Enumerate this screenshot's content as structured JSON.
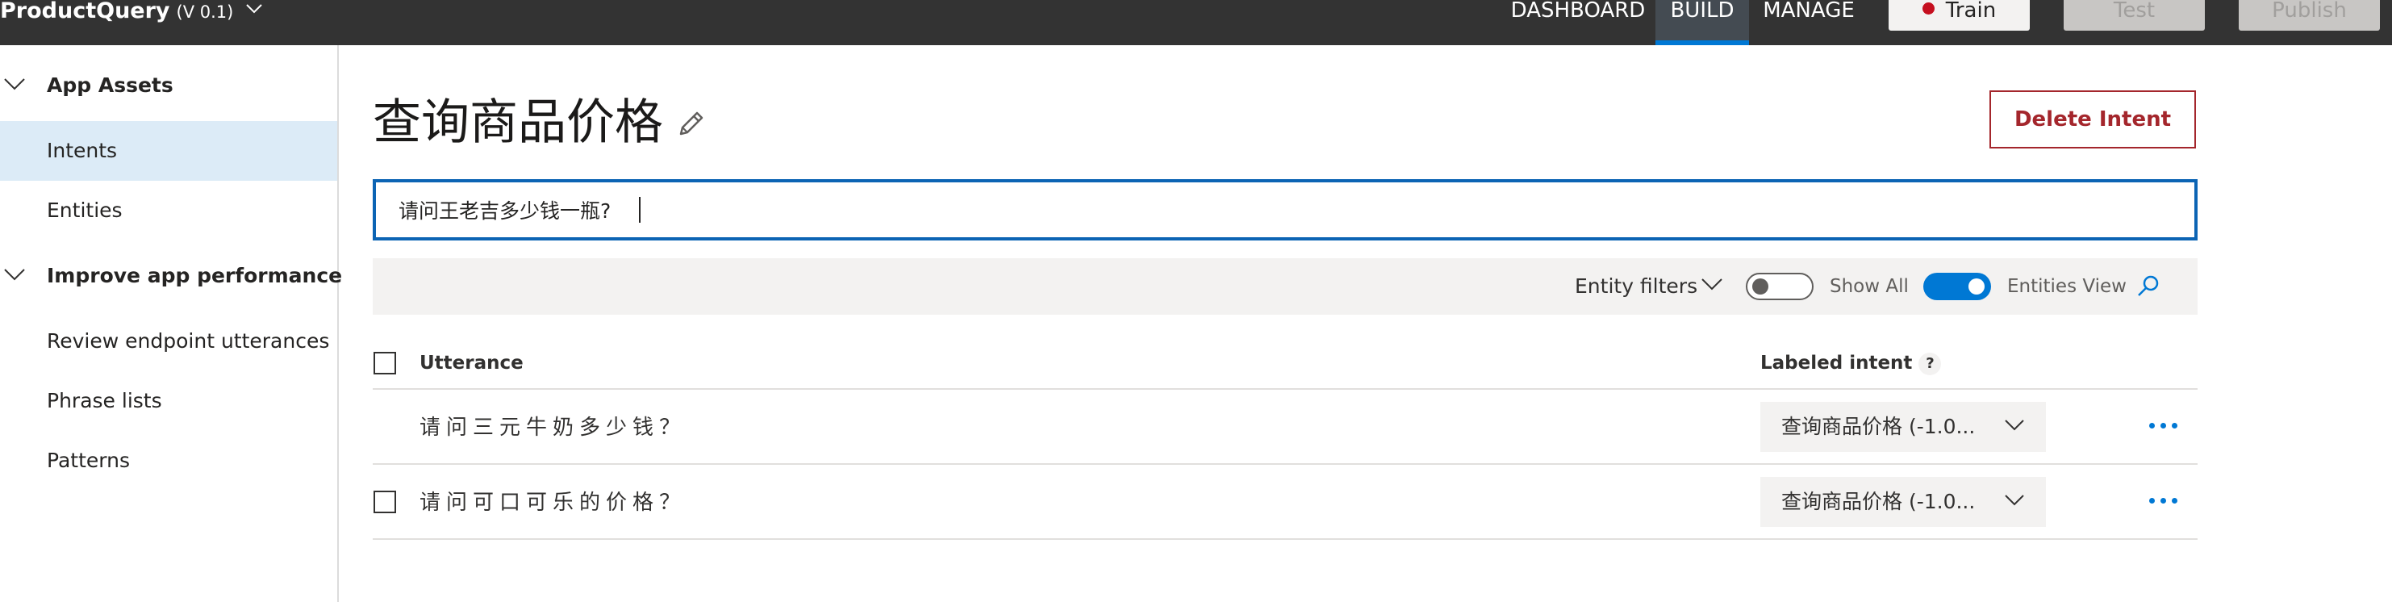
{
  "topbar": {
    "app_name": "ProductQuery",
    "app_version": "(V 0.1)",
    "nav": [
      "DASHBOARD",
      "BUILD",
      "MANAGE"
    ],
    "active_nav": "BUILD",
    "train_label": "Train",
    "test_label": "Test",
    "publish_label": "Publish",
    "icons": {
      "app_menu": "chevron-down-icon",
      "train_status": "red-dot-icon"
    }
  },
  "sidebar": {
    "groups": [
      {
        "label": "App Assets",
        "items": [
          "Intents",
          "Entities"
        ]
      },
      {
        "label": "Improve app performance",
        "items": [
          "Review endpoint utterances",
          "Phrase lists",
          "Patterns"
        ]
      }
    ],
    "active_item": "Intents"
  },
  "main": {
    "title": "查询商品价格",
    "delete_label": "Delete Intent",
    "utterance_input_value": "请问王老吉多少钱一瓶?",
    "filters": {
      "entity_filters_label": "Entity filters",
      "show_all_label": "Show All",
      "show_all_on": false,
      "entities_view_label": "Entities View",
      "entities_view_on": true
    },
    "table": {
      "headers": {
        "utterance": "Utterance",
        "labeled_intent": "Labeled intent",
        "help": "?"
      },
      "rows": [
        {
          "utterance": "请问三元牛奶多少钱？",
          "intent": "查询商品价格 (-1.0...",
          "show_checkbox": false
        },
        {
          "utterance": "请问可口可乐的价格？",
          "intent": "查询商品价格 (-1.0...",
          "show_checkbox": true
        }
      ]
    }
  },
  "colors": {
    "accent": "#0078d4",
    "topbar": "#333333",
    "danger": "#a4262c",
    "active_bg": "#dcebf7"
  }
}
